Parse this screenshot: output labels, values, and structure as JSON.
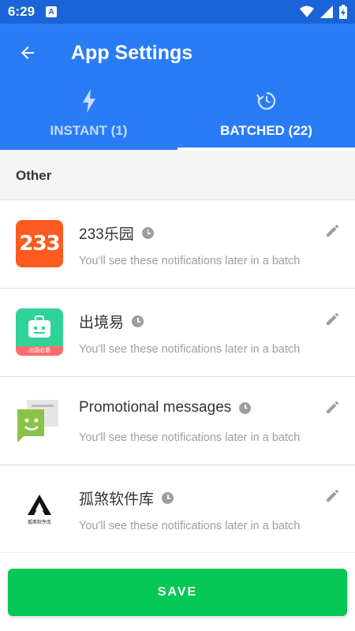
{
  "status_bar": {
    "time": "6:29",
    "notification_glyph": "A",
    "icons": [
      "wifi-icon",
      "signal-icon",
      "battery-charging-icon"
    ]
  },
  "app_bar": {
    "title": "App Settings",
    "back_icon": "back-arrow-icon"
  },
  "tabs": [
    {
      "label": "INSTANT (1)",
      "icon": "lightning-icon",
      "selected": false
    },
    {
      "label": "BATCHED (22)",
      "icon": "clock-refresh-icon",
      "selected": true
    }
  ],
  "section": {
    "title": "Other"
  },
  "apps": [
    {
      "name": "233乐园",
      "description": "You'll see these notifications later in a batch",
      "icon": "app-233-icon",
      "icon_text": "233"
    },
    {
      "name": "出境易",
      "description": "You'll see these notifications later in a batch",
      "icon": "luggage-app-icon",
      "icon_text": "出国必备"
    },
    {
      "name": "Promotional messages",
      "description": "You'll see these notifications later in a batch",
      "icon": "chat-bubble-icon"
    },
    {
      "name": "孤煞软件库",
      "description": "You'll see these notifications later in a batch",
      "icon": "gusha-logo-icon",
      "icon_text": "孤煞软件库"
    }
  ],
  "save_button": {
    "label": "SAVE"
  },
  "colors": {
    "status_bar": "#1a63d8",
    "app_bar": "#2a7cf6",
    "save": "#05c755",
    "secondary_text": "#9e9e9e"
  }
}
